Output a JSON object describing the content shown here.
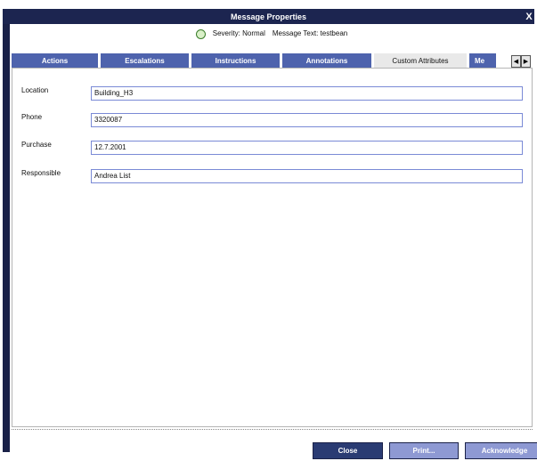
{
  "window": {
    "title": "Message Properties",
    "close_glyph": "X"
  },
  "info": {
    "severity_label": "Severity: Normal",
    "message_text": "Message Text: testbean"
  },
  "tabs": [
    {
      "label": "Actions",
      "active": false
    },
    {
      "label": "Escalations",
      "active": false
    },
    {
      "label": "Instructions",
      "active": false
    },
    {
      "label": "Annotations",
      "active": false
    },
    {
      "label": "Custom Attributes",
      "active": true
    },
    {
      "label": "Me",
      "active": false
    }
  ],
  "tab_nav": {
    "left": "◀",
    "right": "▶"
  },
  "attributes": [
    {
      "label": "Location",
      "value": "Building_H3"
    },
    {
      "label": "Phone",
      "value": "3320087"
    },
    {
      "label": "Purchase",
      "value": "12.7.2001"
    },
    {
      "label": "Responsible",
      "value": "Andrea List"
    }
  ],
  "buttons": {
    "close": "Close",
    "print": "Print...",
    "acknowledge": "Acknowledge"
  },
  "icons": {
    "severity": "lightbulb-icon",
    "window_close": "close-icon",
    "tab_left": "arrow-left-icon",
    "tab_right": "arrow-right-icon"
  },
  "colors": {
    "title_bar": "#1c2550",
    "tab_inactive": "#4e63ad",
    "tab_active": "#e9e9e9",
    "primary_button": "#2a3b73",
    "secondary_button": "#8e99d3",
    "field_border": "#7a8ad6"
  }
}
